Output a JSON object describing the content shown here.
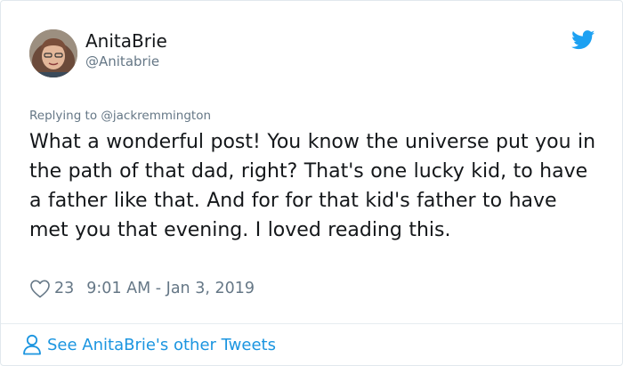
{
  "tweet": {
    "author": {
      "display_name": "AnitaBrie",
      "handle": "@Anitabrie"
    },
    "reply_prefix": "Replying to ",
    "reply_to": "@jackremmington",
    "text": "What a wonderful post! You know the universe put you in the path of that dad, right? That's one lucky kid, to have a father like that. And for for that kid's father to have met you that evening. I loved reading this.",
    "like_count": "23",
    "timestamp": "9:01 AM - Jan 3, 2019"
  },
  "footer": {
    "other_tweets_label": "See AnitaBrie's other Tweets"
  },
  "icons": {
    "brand": "twitter-bird-icon",
    "like": "heart-icon",
    "profile": "person-icon"
  },
  "colors": {
    "accent": "#1da1f2",
    "link": "#1b95e0",
    "secondary_text": "#657786",
    "primary_text": "#14171a",
    "border": "#e1e8ed"
  }
}
